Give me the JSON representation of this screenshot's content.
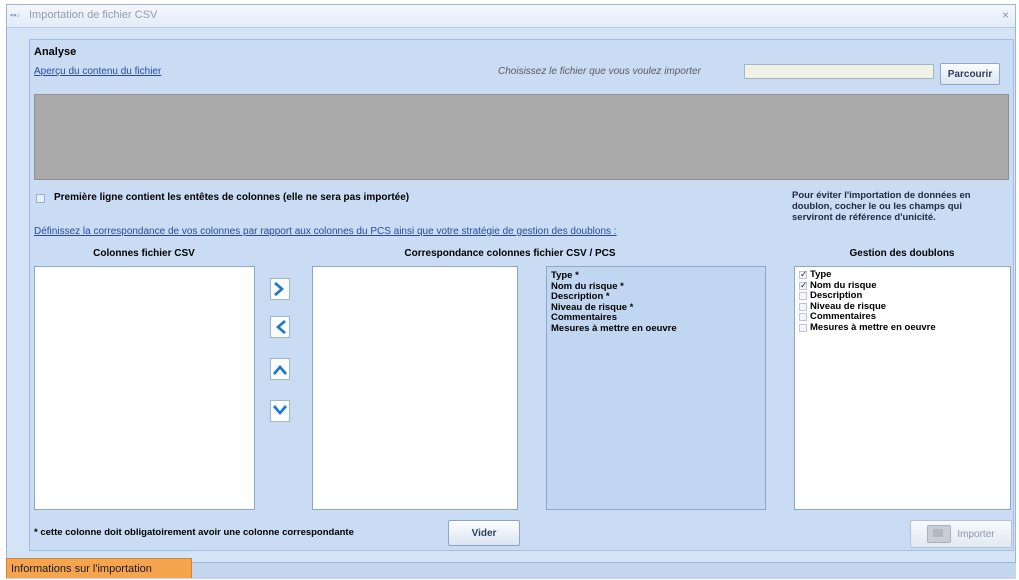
{
  "window": {
    "title": "Importation de fichier CSV",
    "close_glyph": "×"
  },
  "analysis": {
    "section_title": "Analyse",
    "preview_link": "Aperçu du contenu du fichier",
    "choose_label": "Choisissez le fichier que vous voulez importer",
    "file_value": "",
    "browse_label": "Parcourir"
  },
  "options": {
    "first_line_label": "Première ligne contient les entêtes de colonnes (elle ne sera pas importée)",
    "first_line_checked": false,
    "mapping_link": "Définissez la correspondance de vos colonnes par rapport aux colonnes du PCS ainsi que votre stratégie de gestion des doublons :",
    "hint": "Pour éviter l'importation de données en doublon, cocher le ou les champs qui serviront de référence d'unicité."
  },
  "columns": {
    "csv_header": "Colonnes fichier CSV",
    "mapping_header": "Correspondance colonnes fichier CSV / PCS",
    "duplicates_header": "Gestion des doublons",
    "csv_items": [],
    "mapping_items": []
  },
  "pcs_fields": [
    {
      "label": "Type *"
    },
    {
      "label": "Nom du risque *"
    },
    {
      "label": "Description *"
    },
    {
      "label": "Niveau de risque *"
    },
    {
      "label": "Commentaires"
    },
    {
      "label": "Mesures à mettre en oeuvre"
    }
  ],
  "duplicates": [
    {
      "label": "Type",
      "checked": true
    },
    {
      "label": "Nom du risque",
      "checked": true
    },
    {
      "label": "Description",
      "checked": false
    },
    {
      "label": "Niveau de risque",
      "checked": false
    },
    {
      "label": "Commentaires",
      "checked": false
    },
    {
      "label": "Mesures à mettre en oeuvre",
      "checked": false
    }
  ],
  "arrows": {
    "right_icon": "chevron-right-icon",
    "left_icon": "chevron-left-icon",
    "up_icon": "chevron-up-icon",
    "down_icon": "chevron-down-icon",
    "color": "#1e78d2"
  },
  "footer": {
    "note": "* cette colonne doit obligatoirement avoir une colonne correspondante",
    "empty_label": "Vider",
    "import_label": "Importer",
    "import_enabled": false
  },
  "tab": {
    "label": "Informations sur l'importation",
    "color": "#f6a54e"
  }
}
